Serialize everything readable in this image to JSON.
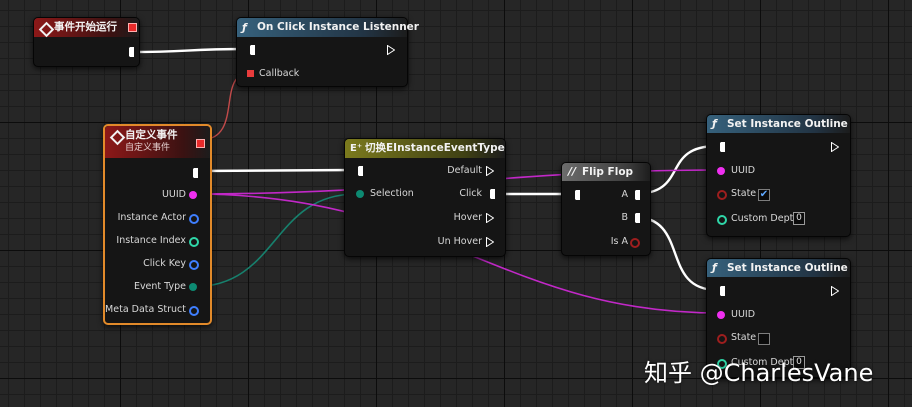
{
  "colors": {
    "exec": "#ffffff",
    "object_ref": "#ef2ff0",
    "struct": "#3f7fff",
    "enum": "#0d8a72",
    "int": "#2fd6a8",
    "delegate": "#e83c3c",
    "bool": "#9e1e1e",
    "selection_border": "#e28a2a"
  },
  "nodes": {
    "begin_play": {
      "title": "事件开始运行",
      "icon": "event-diamond-icon"
    },
    "on_click_listener": {
      "title": "On Click Instance Listenner",
      "icon": "function-icon",
      "pins": {
        "callback": "Callback"
      }
    },
    "custom_event": {
      "title": "自定义事件",
      "subtitle": "自定义事件",
      "pins": {
        "uuid": "UUID",
        "instance_actor": "Instance Actor",
        "instance_index": "Instance Index",
        "click_key": "Click Key",
        "event_type": "Event Type",
        "meta_data_struct": "Meta Data Struct"
      }
    },
    "switch": {
      "title": "切换EInstanceEventType",
      "icon": "switch-enum-icon",
      "pins": {
        "selection": "Selection",
        "default": "Default",
        "click": "Click",
        "hover": "Hover",
        "un_hover": "Un Hover"
      }
    },
    "flip_flop": {
      "title": "Flip Flop",
      "icon": "flipflop-icon",
      "pins": {
        "a": "A",
        "b": "B",
        "is_a": "Is A"
      }
    },
    "set_outline_1": {
      "title": "Set Instance Outline",
      "pins": {
        "uuid": "UUID",
        "state": "State",
        "custom_depth": "Custom Depth"
      },
      "state_checked": true,
      "custom_depth_value": "0"
    },
    "set_outline_2": {
      "title": "Set Instance Outline",
      "pins": {
        "uuid": "UUID",
        "state": "State",
        "custom_depth": "Custom Depth"
      },
      "state_checked": false,
      "custom_depth_value": "0"
    }
  },
  "watermark": "知乎 @CharlesVane"
}
